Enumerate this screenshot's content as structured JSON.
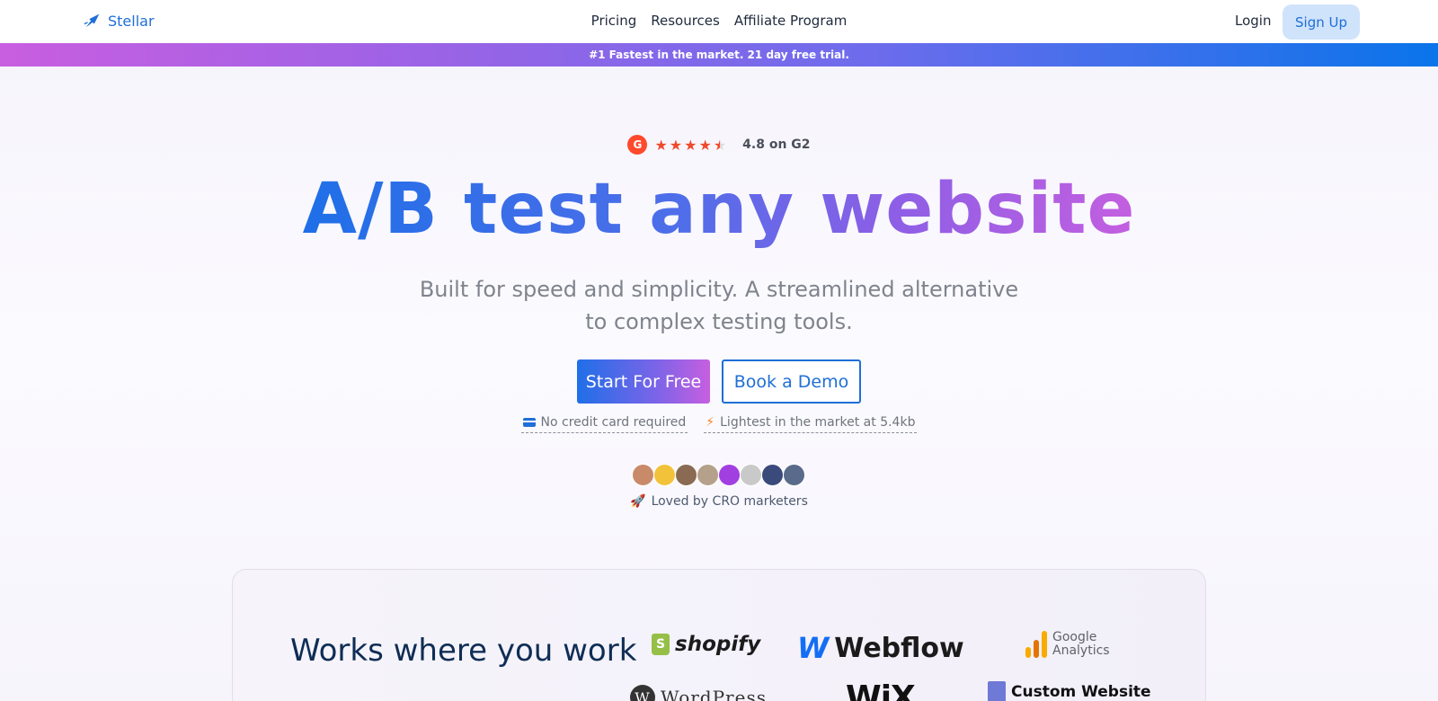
{
  "header": {
    "brand": "Stellar",
    "menu": [
      "Pricing",
      "Resources",
      "Affiliate Program"
    ],
    "login": "Login",
    "signup": "Sign Up"
  },
  "banner": {
    "text": "#1 Fastest in the market. 21 day free trial."
  },
  "rating": {
    "badge": "G",
    "text": "4.8 on G2",
    "stars": 4.5
  },
  "hero": {
    "title": "A/B test any website",
    "subtitle_line1": "Built for speed and simplicity. A streamlined alternative",
    "subtitle_line2": "to complex testing tools.",
    "primary_cta": "Start For Free",
    "secondary_cta": "Book a Demo",
    "feature1": "No credit card required",
    "feature2": "Lightest in the market at 5.4kb",
    "loved": "Loved by CRO marketers"
  },
  "avatars": {
    "colors": [
      "#c98a6a",
      "#f2c23a",
      "#8a6a52",
      "#b5a08c",
      "#a23fe0",
      "#c9c9c9",
      "#3a4a7a",
      "#5a6a8a"
    ]
  },
  "works": {
    "title": "Works where you work",
    "logos": [
      "shopify",
      "Webflow",
      "Google",
      "Analytics",
      "WordPress",
      "WiX",
      "Custom Website"
    ]
  },
  "colors": {
    "accent": "#1f6fd6",
    "banner_start": "#c95ee0",
    "banner_end": "#0a74ea",
    "star": "#ef4a2d"
  }
}
